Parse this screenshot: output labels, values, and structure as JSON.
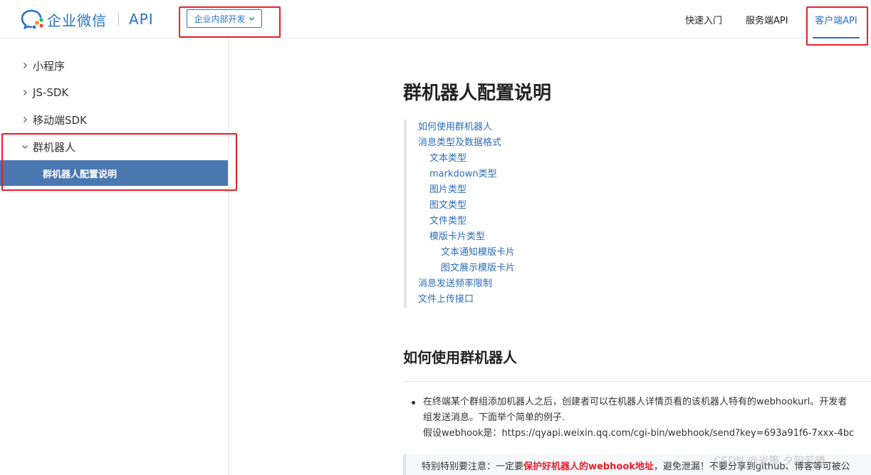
{
  "header": {
    "logo_text": "企业微信",
    "logo_api": "API",
    "dev_select": "企业内部开发",
    "nav": [
      {
        "label": "快速入门",
        "active": false
      },
      {
        "label": "服务端API",
        "active": false
      },
      {
        "label": "客户端API",
        "active": true
      }
    ]
  },
  "sidebar": {
    "items": [
      {
        "label": "小程序",
        "expanded": false
      },
      {
        "label": "JS-SDK",
        "expanded": false
      },
      {
        "label": "移动端SDK",
        "expanded": false
      },
      {
        "label": "群机器人",
        "expanded": true
      }
    ],
    "active_sub": "群机器人配置说明"
  },
  "main": {
    "title": "群机器人配置说明",
    "toc": [
      {
        "label": "如何使用群机器人",
        "level": 1
      },
      {
        "label": "消息类型及数据格式",
        "level": 1
      },
      {
        "label": "文本类型",
        "level": 2
      },
      {
        "label": "markdown类型",
        "level": 2
      },
      {
        "label": "图片类型",
        "level": 2
      },
      {
        "label": "图文类型",
        "level": 2
      },
      {
        "label": "文件类型",
        "level": 2
      },
      {
        "label": "模版卡片类型",
        "level": 2
      },
      {
        "label": "文本通知模版卡片",
        "level": 3
      },
      {
        "label": "图文展示模版卡片",
        "level": 3
      },
      {
        "label": "消息发送频率限制",
        "level": 1
      },
      {
        "label": "文件上传接口",
        "level": 1
      }
    ],
    "section_title": "如何使用群机器人",
    "para_line1": "在终端某个群组添加机器人之后，创建者可以在机器人详情页看的该机器人特有的webhookurl。开发者",
    "para_line2": "组发送消息。下面举个简单的例子.",
    "para_line3": "假设webhook是：https://qyapi.weixin.qq.com/cgi-bin/webhook/send?key=693a91f6-7xxx-4bc",
    "note_prefix": "特别特别要注意：一定要",
    "note_red": "保护好机器人的webhook地址",
    "note_suffix": "，避免泄漏！不要分享到github、博客等可被公"
  },
  "watermark": "CSDN @光策 夕阳若曦",
  "colors": {
    "accent": "#2672c8",
    "sidebar_active_bg": "#4a77b0",
    "annotation_red": "#e8202a",
    "link": "#2c6db5"
  }
}
